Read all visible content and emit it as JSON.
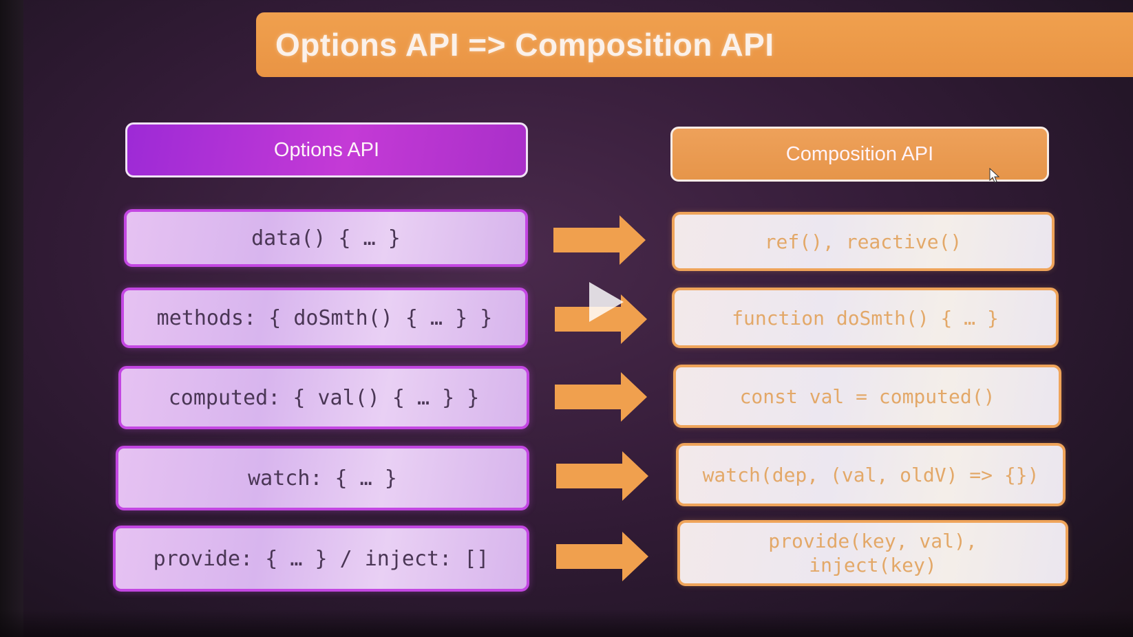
{
  "slide": {
    "title": "Options API => Composition API",
    "options_header": "Options API",
    "composition_header": "Composition API",
    "rows": [
      {
        "options": "data() { … }",
        "composition": "ref(), reactive()"
      },
      {
        "options": "methods: { doSmth() { … } }",
        "composition": "function doSmth() { … }"
      },
      {
        "options": "computed: { val() { … } }",
        "composition": "const val = computed()"
      },
      {
        "options": "watch: { … }",
        "composition": "watch(dep, (val, oldV) => {})"
      },
      {
        "options": "provide: { … } / inject: []",
        "composition": "provide(key, val),\ninject(key)"
      }
    ]
  },
  "icons": {
    "arrow": "right-arrow-icon",
    "play": "play-icon",
    "cursor": "mouse-cursor-icon"
  },
  "colors": {
    "options_accent": "#c347e2",
    "composition_accent": "#efa45a",
    "title_banner": "#ec9a48"
  }
}
